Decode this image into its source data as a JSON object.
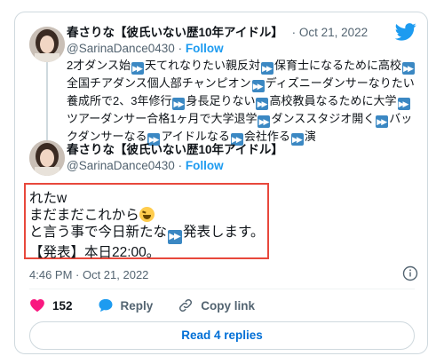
{
  "quoted_tweet": {
    "author_name": "春さりな【彼氏いない歴10年アイドル】",
    "separator": "·",
    "date": "Oct 21, 2022",
    "handle": "@SarinaDance0430",
    "follow_separator": "·",
    "follow_label": "Follow",
    "text_segments": [
      "2才ダンス始",
      "天てれなりたい親反対",
      "保育士になるために高校",
      "全国チアダンス個人部チャンピオン",
      "ディズニーダンサーなりたい養成所で2、3年修行",
      "身長足りない",
      "高校教員なるために大学",
      "ツアーダンサー合格1ヶ月で大学退学",
      "ダンススタジオ開く",
      "バックダンサーなる",
      "アイドルなる",
      "会社作る",
      "演"
    ]
  },
  "main_tweet": {
    "author_name": "春さりな【彼氏いない歴10年アイドル】",
    "handle": "@SarinaDance0430",
    "follow_separator": "·",
    "follow_label": "Follow",
    "lines": {
      "line1": "れたw",
      "line2": "まだまだこれから",
      "line3_a": "と言う事で今日新たな",
      "line3_b": "発表します。",
      "line4": "【発表】本日22:00。"
    },
    "emoji": "squinting-face-with-tongue",
    "timestamp": "4:46 PM · Oct 21, 2022"
  },
  "actions": {
    "like_count": "152",
    "reply_label": "Reply",
    "copy_link_label": "Copy link"
  },
  "read_replies_label": "Read 4 replies",
  "colors": {
    "accent_blue": "#1d9bf0",
    "link_blue": "#006fd6",
    "like_red": "#f91880",
    "highlight_border": "#e8483c",
    "ff_icon_blue": "#3b88c3"
  }
}
